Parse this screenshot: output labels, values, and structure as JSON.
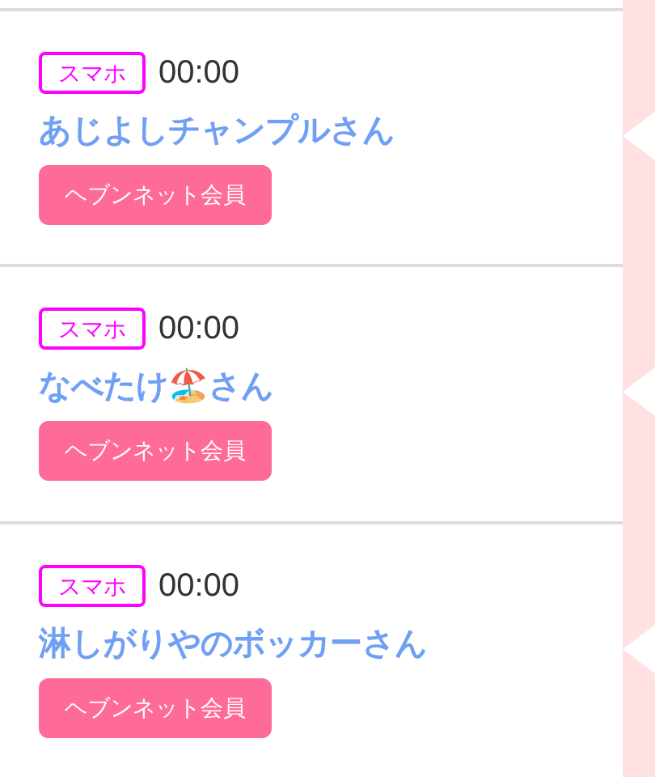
{
  "members": [
    {
      "device": "スマホ",
      "time": "00:00",
      "name": "あじよしチャンプルさん",
      "badge": "ヘブンネット会員"
    },
    {
      "device": "スマホ",
      "time": "00:00",
      "name": "なべたけ🏖️さん",
      "badge": "ヘブンネット会員"
    },
    {
      "device": "スマホ",
      "time": "00:00",
      "name": "淋しがりやのボッカーさん",
      "badge": "ヘブンネット会員"
    }
  ]
}
